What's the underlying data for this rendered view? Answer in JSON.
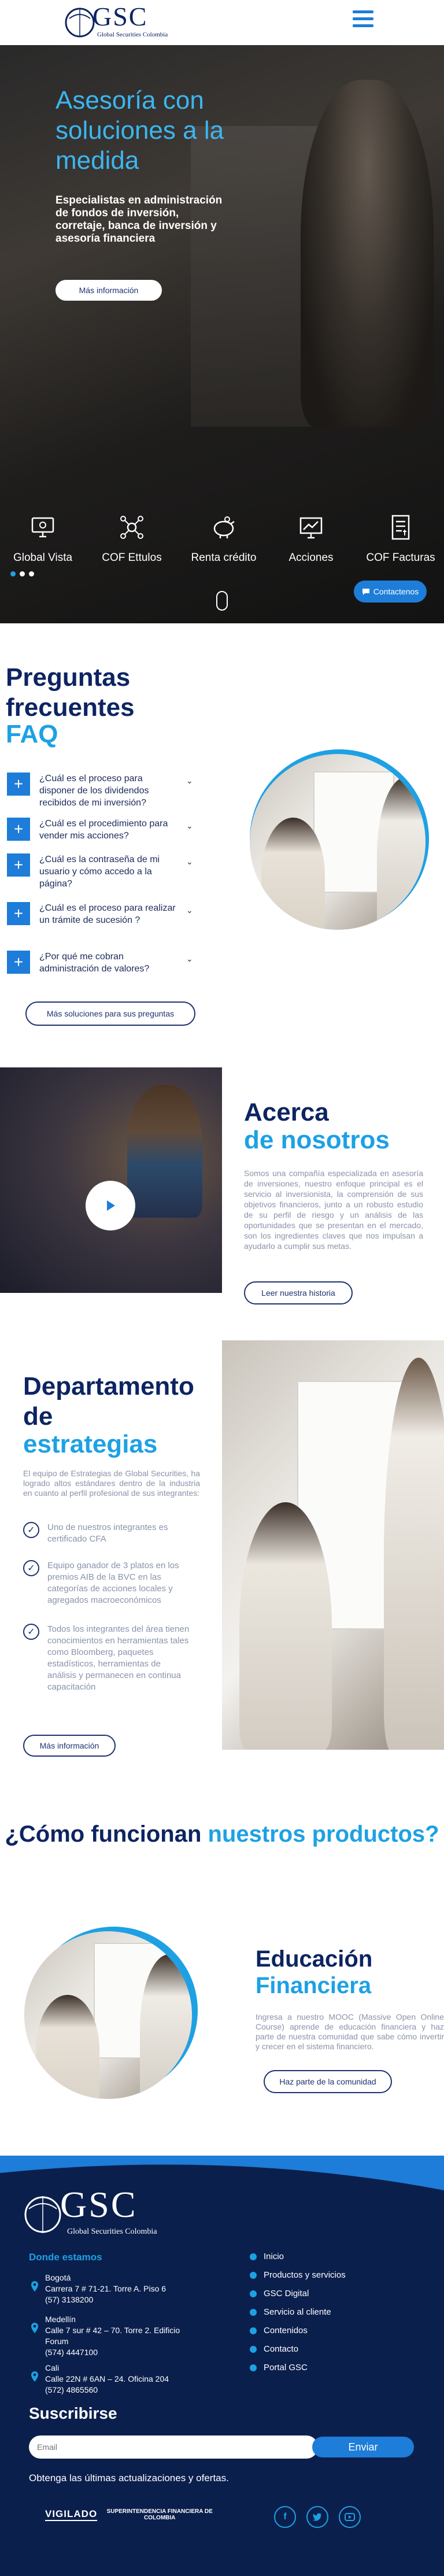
{
  "header": {
    "logo_text": "GSC",
    "logo_subtitle": "Global Securities Colombia"
  },
  "hero": {
    "title": "Asesoría con soluciones a la medida",
    "subtitle": "Especialistas en administración de fondos de inversión, corretaje, banca de inversión y asesoría financiera",
    "cta": "Más información",
    "features": [
      {
        "label": "Global Vista",
        "icon": "computer-icon"
      },
      {
        "label": "COF Ettulos",
        "icon": "network-icon"
      },
      {
        "label": "Renta crédito",
        "icon": "piggy-bank-icon"
      },
      {
        "label": "Acciones",
        "icon": "chart-icon"
      },
      {
        "label": "COF Facturas",
        "icon": "invoice-icon"
      }
    ],
    "contact_button": "Contactenos"
  },
  "faq": {
    "title": "Preguntas frecuentes",
    "title_accent": "FAQ",
    "questions": [
      "¿Cuál es el proceso para disponer de los dividendos recibidos de mi inversión?",
      "¿Cuál es el procedimiento para vender mis acciones?",
      "¿Cuál es la contraseña de mi usuario y cómo accedo a la página?",
      "¿Cuál es el proceso para realizar un trámite de sucesión ?",
      "¿Por qué me cobran administración de valores?"
    ],
    "more_button": "Más soluciones para sus preguntas"
  },
  "about": {
    "title": "Acerca",
    "title_accent": "de nosotros",
    "body": "Somos una compañía especializada en asesoría de inversiones, nuestro enfoque principal es el servicio al inversionista, la comprensión de sus objetivos financieros, junto a un robusto estudio de su perfil de riesgo y un análisis de las oportunidades que se presentan en el mercado, son los ingredientes claves que nos impulsan a ayudarlo a cumplir sus metas.",
    "cta": "Leer nuestra historia"
  },
  "strategy": {
    "title": "Departamento de",
    "title_accent": "estrategias",
    "intro": "El equipo de Estrategias de Global Securities, ha logrado altos estándares dentro de la industria en cuanto al perfil profesional de sus integrantes:",
    "points": [
      "Uno de nuestros integrantes es certificado CFA",
      "Equipo ganador de 3 platos en los premios AIB de la BVC en las categorías de acciones locales y agregados macroeconómicos",
      "Todos los integrantes del área tienen conocimientos en herramientas tales como Bloomberg, paquetes estadísticos, herramientas de análisis y permanecen en continua capacitación"
    ],
    "cta": "Más información"
  },
  "how": {
    "title": "¿Cómo funcionan",
    "title_accent": "nuestros productos?"
  },
  "education": {
    "title": "Educación",
    "title_accent": "Financiera",
    "body": "Ingresa a nuestro MOOC (Massive Open Online Course) aprende de educación financiera y haz parte de nuestra comunidad que sabe cómo invertir y crecer en el sistema financiero.",
    "cta": "Haz parte de la comunidad"
  },
  "footer": {
    "logo_text": "GSC",
    "logo_subtitle": "Global Securities Colombia",
    "where_title": "Donde estamos",
    "locations": [
      {
        "city": "Bogotá",
        "address": "Carrera 7 # 71-21. Torre A. Piso 6",
        "phone": "(57) 3138200"
      },
      {
        "city": "Medellín",
        "address": "Calle 7 sur # 42 – 70. Torre 2. Edificio Forum",
        "phone": "(574) 4447100"
      },
      {
        "city": "Cali",
        "address": "Calle 22N # 6AN – 24. Oficina 204",
        "phone": "(572) 4865560"
      }
    ],
    "links": [
      "Inicio",
      "Productos y servicios",
      "GSC Digital",
      "Servicio al cliente",
      "Contenidos",
      "Contacto",
      "Portal GSC"
    ],
    "subscribe_title": "Suscribirse",
    "email_placeholder": "Email",
    "send_button": "Enviar",
    "subscribe_text": "Obtenga las últimas actualizaciones y ofertas.",
    "vigilado": "VIGILADO",
    "superintendencia": "SUPERINTENDENCIA FINANCIERA DE COLOMBIA",
    "social": [
      "f",
      "t",
      "yt"
    ]
  },
  "colors": {
    "navy": "#0d2462",
    "accent": "#1da1e4",
    "button_blue": "#1d7dd8",
    "footer_bg": "#0b1f4d"
  }
}
